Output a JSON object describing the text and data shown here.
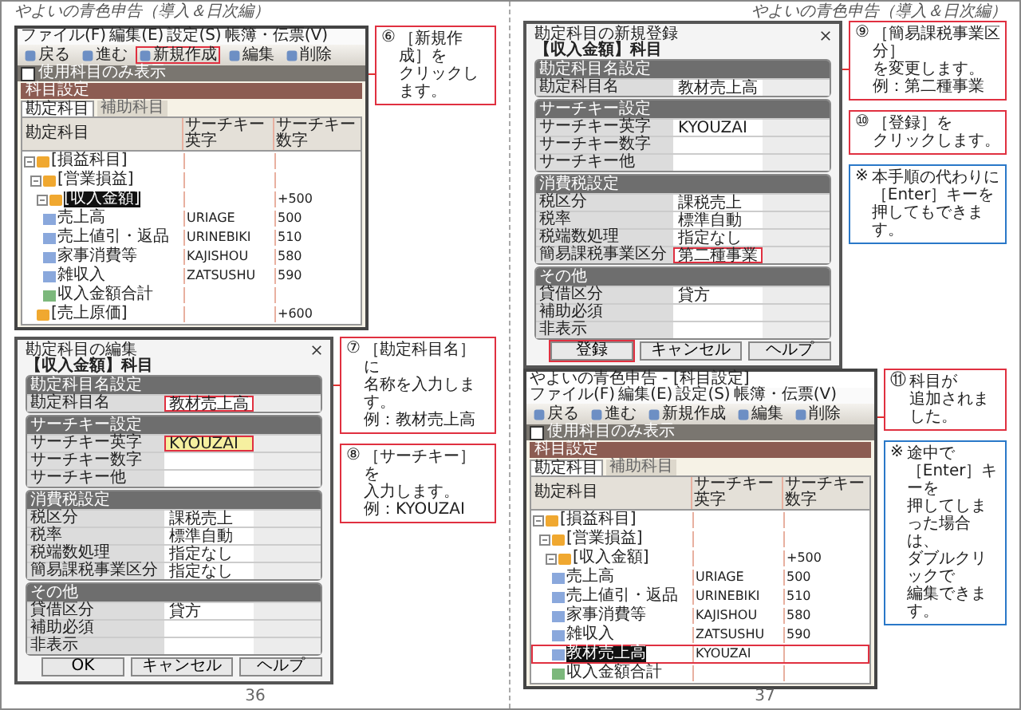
{
  "left_page": {
    "header": "やよいの青色申告（導入＆日次編）",
    "app_window": {
      "menu": [
        "ファイル(F)",
        "編集(E)",
        "設定(S)",
        "帳簿・伝票(V)"
      ],
      "toolbar": [
        {
          "label": "戻る",
          "highlighted": false
        },
        {
          "label": "進む",
          "highlighted": false
        },
        {
          "label": "新規作成",
          "highlighted": true
        },
        {
          "label": "編集",
          "highlighted": false
        },
        {
          "label": "削除",
          "highlighted": false
        }
      ],
      "filter": {
        "label": "使用科目のみ表示",
        "checked": false
      },
      "panel_title": "科目設定",
      "tabs": [
        {
          "label": "勘定科目",
          "selected": true
        },
        {
          "label": "補助科目",
          "selected": false
        }
      ],
      "columns": [
        "勘定科目",
        "サーチキー英字",
        "サーチキー数字"
      ],
      "tree": [
        {
          "name": "[損益科目]",
          "kind": "folder",
          "selected": false,
          "highlighted": false,
          "children": [
            {
              "name": "[営業損益]",
              "kind": "folder",
              "selected": false,
              "highlighted": false,
              "children": [
                {
                  "name": "[収入金額]",
                  "kind": "folder",
                  "search_number": "+500",
                  "selected": true,
                  "highlighted": false,
                  "children": [
                    {
                      "name": "売上高",
                      "kind": "account",
                      "search_alpha": "URIAGE",
                      "search_number": "500",
                      "selected": false,
                      "highlighted": false
                    },
                    {
                      "name": "売上値引・返品",
                      "kind": "account",
                      "search_alpha": "URINEBIKI",
                      "search_number": "510",
                      "selected": false,
                      "highlighted": false
                    },
                    {
                      "name": "家事消費等",
                      "kind": "account",
                      "search_alpha": "KAJISHOU",
                      "search_number": "580",
                      "selected": false,
                      "highlighted": false
                    },
                    {
                      "name": "雑収入",
                      "kind": "account",
                      "search_alpha": "ZATSUSHU",
                      "search_number": "590",
                      "selected": false,
                      "highlighted": false
                    },
                    {
                      "name": "収入金額合計",
                      "kind": "total",
                      "selected": false,
                      "highlighted": false
                    }
                  ]
                },
                {
                  "name": "[売上原価]",
                  "kind": "folder",
                  "search_number": "+600",
                  "selected": false,
                  "highlighted": false
                }
              ]
            }
          ]
        }
      ]
    },
    "callouts_top": [
      {
        "kind": "step",
        "number": "⑥",
        "lines": [
          "［新規作成］を",
          "クリックします。"
        ]
      }
    ],
    "dialog": {
      "title": "勘定科目の編集",
      "subject": "【収入金額】科目",
      "sections": [
        {
          "title": "勘定科目名設定",
          "rows": [
            {
              "label": "勘定科目名",
              "value": "教材売上高",
              "highlighted": true,
              "focused": false
            }
          ]
        },
        {
          "title": "サーチキー設定",
          "rows": [
            {
              "label": "サーチキー英字",
              "value": "KYOUZAI",
              "highlighted": true,
              "focused": true
            },
            {
              "label": "サーチキー数字",
              "highlighted": false,
              "focused": false
            },
            {
              "label": "サーチキー他",
              "highlighted": false,
              "focused": false
            }
          ]
        },
        {
          "title": "消費税設定",
          "rows": [
            {
              "label": "税区分",
              "value": "課税売上",
              "highlighted": false,
              "focused": false
            },
            {
              "label": "税率",
              "value": "標準自動",
              "highlighted": false,
              "focused": false
            },
            {
              "label": "税端数処理",
              "value": "指定なし",
              "highlighted": false,
              "focused": false
            },
            {
              "label": "簡易課税事業区分",
              "value": "指定なし",
              "highlighted": false,
              "focused": false
            }
          ]
        },
        {
          "title": "その他",
          "rows": [
            {
              "label": "貸借区分",
              "value": "貸方",
              "highlighted": false,
              "focused": false
            },
            {
              "label": "補助必須",
              "highlighted": false,
              "focused": false
            },
            {
              "label": "非表示",
              "highlighted": false,
              "focused": false
            }
          ]
        }
      ],
      "buttons": [
        {
          "label": "OK",
          "highlighted": false
        },
        {
          "label": "キャンセル",
          "highlighted": false
        },
        {
          "label": "ヘルプ",
          "highlighted": false
        }
      ]
    },
    "callouts_bottom": [
      {
        "kind": "step",
        "number": "⑦",
        "lines": [
          "［勘定科目名］に",
          "名称を入力します。",
          "例：教材売上高"
        ]
      },
      {
        "kind": "step",
        "number": "⑧",
        "lines": [
          "［サーチキー］を",
          "入力します。",
          "例：KYOUZAI"
        ]
      }
    ],
    "page_number": "36"
  },
  "right_page": {
    "header": "やよいの青色申告（導入＆日次編）",
    "dialog": {
      "title": "勘定科目の新規登録",
      "subject": "【収入金額】科目",
      "sections": [
        {
          "title": "勘定科目名設定",
          "rows": [
            {
              "label": "勘定科目名",
              "value": "教材売上高",
              "highlighted": false,
              "focused": false
            }
          ]
        },
        {
          "title": "サーチキー設定",
          "rows": [
            {
              "label": "サーチキー英字",
              "value": "KYOUZAI",
              "highlighted": false,
              "focused": false
            },
            {
              "label": "サーチキー数字",
              "highlighted": false,
              "focused": false
            },
            {
              "label": "サーチキー他",
              "highlighted": false,
              "focused": false
            }
          ]
        },
        {
          "title": "消費税設定",
          "rows": [
            {
              "label": "税区分",
              "value": "課税売上",
              "highlighted": false,
              "focused": false
            },
            {
              "label": "税率",
              "value": "標準自動",
              "highlighted": false,
              "focused": false
            },
            {
              "label": "税端数処理",
              "value": "指定なし",
              "highlighted": false,
              "focused": false
            },
            {
              "label": "簡易課税事業区分",
              "value": "第二種事業",
              "highlighted": true,
              "focused": false
            }
          ]
        },
        {
          "title": "その他",
          "rows": [
            {
              "label": "貸借区分",
              "value": "貸方",
              "highlighted": false,
              "focused": false
            },
            {
              "label": "補助必須",
              "highlighted": false,
              "focused": false
            },
            {
              "label": "非表示",
              "highlighted": false,
              "focused": false
            }
          ]
        }
      ],
      "buttons": [
        {
          "label": "登録",
          "highlighted": true
        },
        {
          "label": "キャンセル",
          "highlighted": false
        },
        {
          "label": "ヘルプ",
          "highlighted": false
        }
      ]
    },
    "callouts_top": [
      {
        "kind": "step",
        "number": "⑨",
        "lines": [
          "［簡易課税事業区分］",
          "を変更します。",
          "例：第二種事業"
        ]
      },
      {
        "kind": "step",
        "number": "⑩",
        "lines": [
          "［登録］を",
          "クリックします。"
        ]
      },
      {
        "kind": "note",
        "number": "※",
        "lines": [
          "本手順の代わりに",
          "［Enter］キーを",
          "押してもできます。"
        ]
      }
    ],
    "app_window": {
      "title": "やよいの青色申告 - [科目設定]",
      "menu": [
        "ファイル(F)",
        "編集(E)",
        "設定(S)",
        "帳簿・伝票(V)"
      ],
      "toolbar": [
        {
          "label": "戻る",
          "highlighted": false
        },
        {
          "label": "進む",
          "highlighted": false
        },
        {
          "label": "新規作成",
          "highlighted": false
        },
        {
          "label": "編集",
          "highlighted": false
        },
        {
          "label": "削除",
          "highlighted": false
        }
      ],
      "filter": {
        "label": "使用科目のみ表示",
        "checked": false
      },
      "panel_title": "科目設定",
      "tabs": [
        {
          "label": "勘定科目",
          "selected": true
        },
        {
          "label": "補助科目",
          "selected": false
        }
      ],
      "columns": [
        "勘定科目",
        "サーチキー英字",
        "サーチキー数字"
      ],
      "tree": [
        {
          "name": "[損益科目]",
          "kind": "folder",
          "selected": false,
          "highlighted": false,
          "children": [
            {
              "name": "[営業損益]",
              "kind": "folder",
              "selected": false,
              "highlighted": false,
              "children": [
                {
                  "name": "[収入金額]",
                  "kind": "folder",
                  "search_number": "+500",
                  "selected": false,
                  "highlighted": false,
                  "children": [
                    {
                      "name": "売上高",
                      "kind": "account",
                      "search_alpha": "URIAGE",
                      "search_number": "500",
                      "selected": false,
                      "highlighted": false
                    },
                    {
                      "name": "売上値引・返品",
                      "kind": "account",
                      "search_alpha": "URINEBIKI",
                      "search_number": "510",
                      "selected": false,
                      "highlighted": false
                    },
                    {
                      "name": "家事消費等",
                      "kind": "account",
                      "search_alpha": "KAJISHOU",
                      "search_number": "580",
                      "selected": false,
                      "highlighted": false
                    },
                    {
                      "name": "雑収入",
                      "kind": "account",
                      "search_alpha": "ZATSUSHU",
                      "search_number": "590",
                      "selected": false,
                      "highlighted": false
                    },
                    {
                      "name": "教材売上高",
                      "kind": "account",
                      "search_alpha": "KYOUZAI",
                      "selected": true,
                      "highlighted": true
                    },
                    {
                      "name": "収入金額合計",
                      "kind": "total",
                      "selected": false,
                      "highlighted": false
                    }
                  ]
                }
              ]
            }
          ]
        }
      ]
    },
    "callouts_bottom": [
      {
        "kind": "step",
        "number": "⑪",
        "lines": [
          "科目が",
          "追加されました。"
        ]
      },
      {
        "kind": "note",
        "number": "※",
        "lines": [
          "途中で［Enter］キーを",
          "押してしまった場合は、",
          "ダブルクリックで",
          "編集できます。"
        ]
      }
    ],
    "page_number": "37"
  }
}
